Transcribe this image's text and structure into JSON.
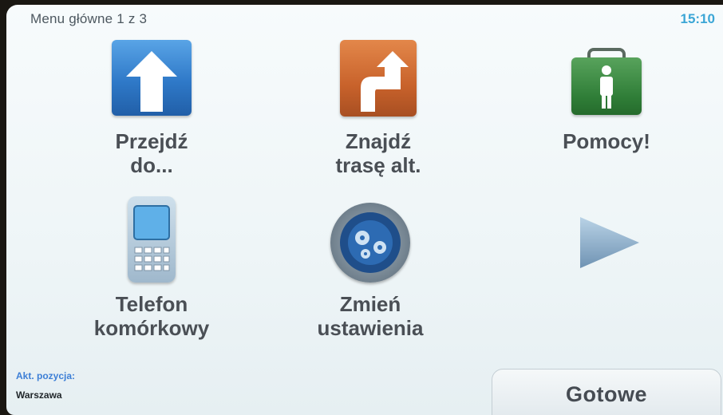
{
  "header": {
    "title": "Menu główne 1 z 3",
    "time": "15:10"
  },
  "tiles": [
    {
      "line1": "Przejdź",
      "line2": "do...",
      "icon": "go-to-arrow-icon"
    },
    {
      "line1": "Znajdź",
      "line2": "trasę alt.",
      "icon": "alternative-route-icon"
    },
    {
      "line1": "Pomocy!",
      "line2": "",
      "icon": "first-aid-kit-icon"
    },
    {
      "line1": "Telefon",
      "line2": "komórkowy",
      "icon": "mobile-phone-icon"
    },
    {
      "line1": "Zmień",
      "line2": "ustawienia",
      "icon": "settings-icon"
    }
  ],
  "next_page": {
    "icon": "next-page-arrow-icon"
  },
  "status": {
    "label": "Akt. pozycja:",
    "value": "Warszawa"
  },
  "footer": {
    "done_label": "Gotowe"
  },
  "colors": {
    "goto": "#2f79c8",
    "alt": "#c8622b",
    "help": "#2f7d37",
    "clock": "#3ba6d6"
  }
}
